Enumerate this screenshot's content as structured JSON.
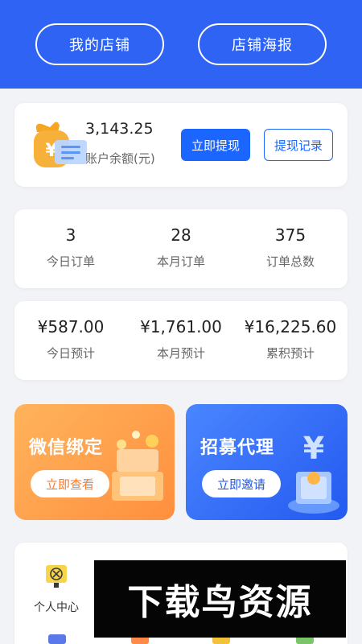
{
  "header": {
    "my_store": "我的店铺",
    "store_poster": "店铺海报"
  },
  "balance": {
    "amount": "3,143.25",
    "label": "账户余额(元)",
    "withdraw_label": "立即提现",
    "records_label": "提现记录",
    "icon": "wallet-icon"
  },
  "orders": [
    {
      "value": "3",
      "label": "今日订单"
    },
    {
      "value": "28",
      "label": "本月订单"
    },
    {
      "value": "375",
      "label": "订单总数"
    }
  ],
  "estimates": [
    {
      "value": "¥587.00",
      "label": "今日预计"
    },
    {
      "value": "¥1,761.00",
      "label": "本月预计"
    },
    {
      "value": "¥16,225.60",
      "label": "累积预计"
    }
  ],
  "banners": {
    "wechat": {
      "title": "微信绑定",
      "button": "立即查看"
    },
    "recruit": {
      "title": "招募代理",
      "button": "立即邀请"
    }
  },
  "menu": [
    {
      "label": "个人中心",
      "icon": "personal-center-icon"
    }
  ],
  "watermark": "下载鸟资源",
  "colors": {
    "primary": "#2f63f4",
    "button_blue": "#1a66ff",
    "orange": "#ff8f3e"
  }
}
